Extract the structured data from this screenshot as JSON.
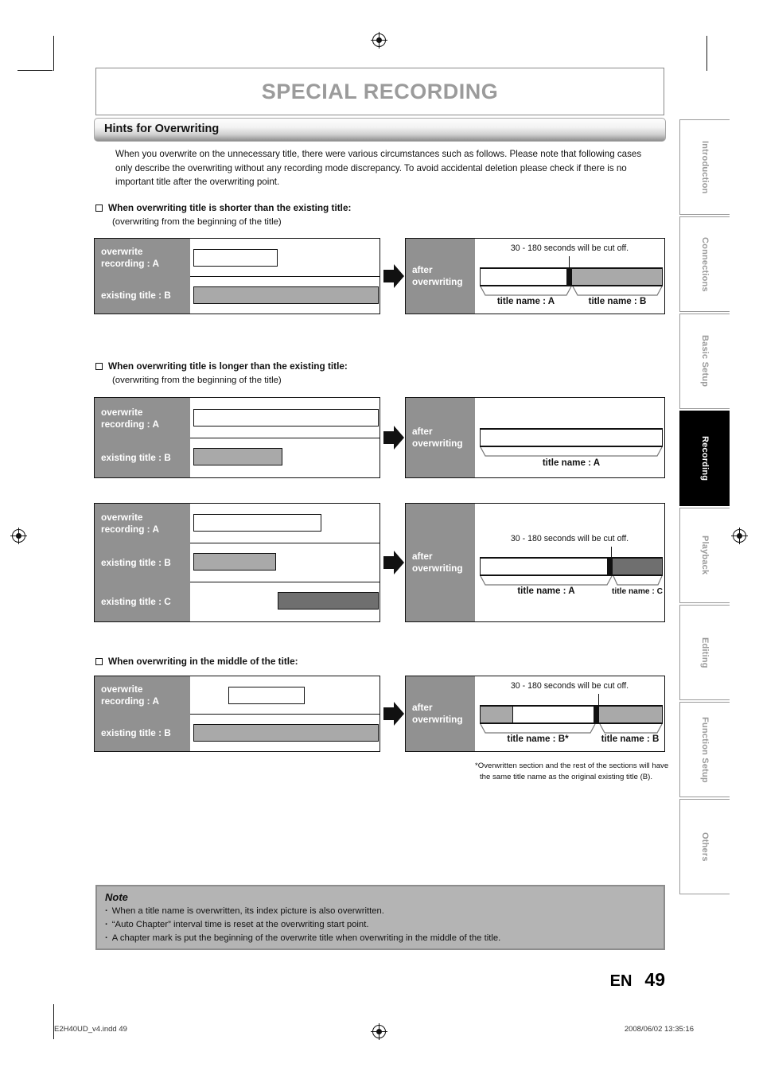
{
  "header": {
    "chapter_title": "SPECIAL RECORDING",
    "section_title": "Hints for Overwriting"
  },
  "intro": "When you overwrite on the unnecessary title, there were various circumstances such as follows.  Please note that following cases only describe the overwriting without any recording mode discrepancy.  To avoid accidental deletion please check if there is no important title after the overwriting point.",
  "labels": {
    "overwrite_recording_a": "overwrite\nrecording : A",
    "existing_title_b": "existing title : B",
    "existing_title_c": "existing title : C",
    "after_overwriting": "after\noverwriting",
    "cut_off_note": "30 - 180 seconds will be cut off.",
    "title_name_a": "title name : A",
    "title_name_b": "title name : B",
    "title_name_c": "title name : C",
    "title_name_b_star": "title name : B*"
  },
  "cases": [
    {
      "heading": "When overwriting title is shorter than the existing title:",
      "sub": "(overwriting from the beginning of the title)"
    },
    {
      "heading": "When overwriting title is longer than the existing title:",
      "sub": "(overwriting from the beginning of the title)"
    },
    {
      "heading": "When overwriting in the middle of the title:",
      "sub": ""
    }
  ],
  "footnote": "*Overwritten section and the rest of the sections will have the same title name as the original existing title (B).",
  "note": {
    "title": "Note",
    "items": [
      "When a title name is overwritten, its index picture is also overwritten.",
      "“Auto Chapter” interval time is reset at the overwriting start point.",
      "A chapter mark is put the beginning of the overwrite title when overwriting in the middle of the title."
    ]
  },
  "sidebar": {
    "tabs": [
      {
        "label": "Introduction",
        "active": false
      },
      {
        "label": "Connections",
        "active": false
      },
      {
        "label": "Basic Setup",
        "active": false
      },
      {
        "label": "Recording",
        "active": true
      },
      {
        "label": "Playback",
        "active": false
      },
      {
        "label": "Editing",
        "active": false
      },
      {
        "label": "Function Setup",
        "active": false
      },
      {
        "label": "Others",
        "active": false
      }
    ]
  },
  "page_footer": {
    "lang": "EN",
    "page_number": "49"
  },
  "print_footer": {
    "file": "E2H40UD_v4.indd   49",
    "timestamp": "2008/06/02   13:35:16"
  },
  "colors": {
    "label_gray": "#919191",
    "bar_light_gray": "#a9a9a9",
    "bar_dark_gray": "#6f6f6f",
    "note_bg": "#b4b4b4",
    "title_gray": "#9b9b9b"
  }
}
